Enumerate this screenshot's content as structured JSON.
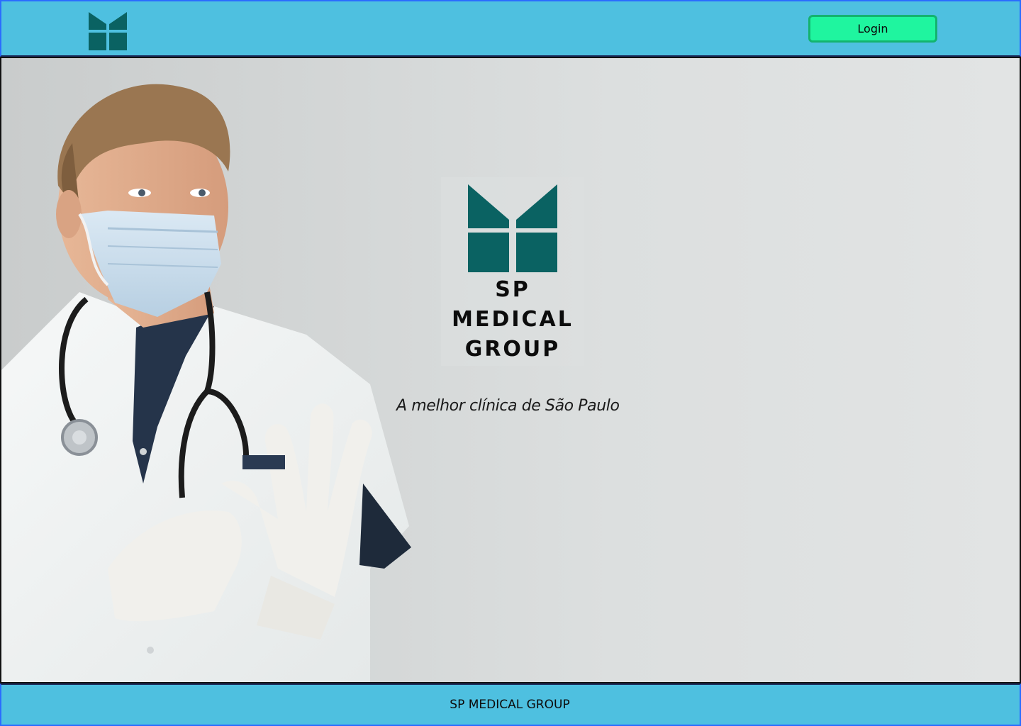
{
  "colors": {
    "header_bg": "#4ec0e0",
    "login_bg": "#1ff59f",
    "logo_teal": "#0a6262",
    "hero_bg": "#d4d7d7"
  },
  "header": {
    "logo_icon": "sp-medical-logo-icon",
    "login_label": "Login"
  },
  "hero": {
    "logo": {
      "line1": "SP",
      "line2": "MEDICAL",
      "line3": "GROUP"
    },
    "tagline": "A melhor clínica de São Paulo",
    "photo_icon": "doctor-photo"
  },
  "footer": {
    "text": "SP MEDICAL GROUP"
  }
}
